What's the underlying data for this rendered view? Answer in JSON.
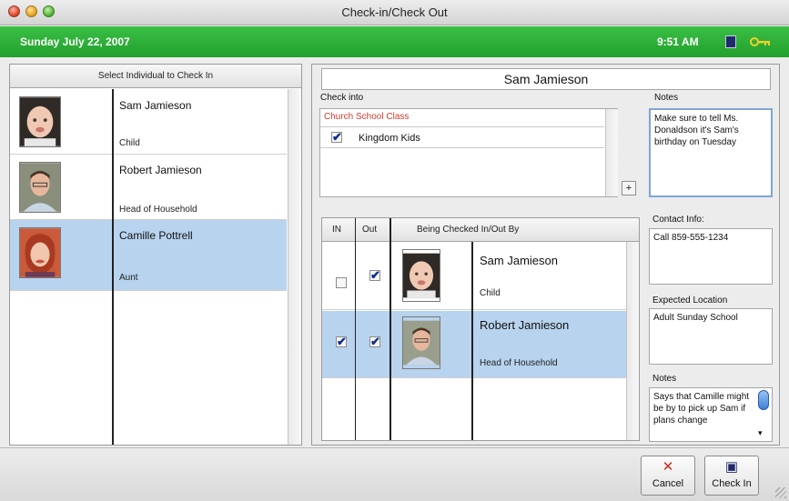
{
  "window": {
    "title": "Check-in/Check Out"
  },
  "header": {
    "date": "Sunday July 22, 2007",
    "time": "9:51 AM"
  },
  "left_panel": {
    "title": "Select Individual to Check In",
    "people": [
      {
        "name": "Sam Jamieson",
        "role": "Child"
      },
      {
        "name": "Robert Jamieson",
        "role": "Head of Household"
      },
      {
        "name": "Camille Pottrell",
        "role": "Aunt"
      }
    ]
  },
  "right_panel": {
    "selected_name": "Sam Jamieson",
    "check_into_label": "Check into",
    "class_header": "Church School Class",
    "class_item": "Kingdom Kids",
    "plus_label": "+",
    "notes_label": "Notes",
    "notes_text": "Make sure to tell Ms. Donaldson it's Sam's birthday on Tuesday",
    "grid": {
      "col_in": "IN",
      "col_out": "Out",
      "col_by": "Being Checked In/Out By",
      "rows": [
        {
          "name": "Sam Jamieson",
          "role": "Child",
          "in": false,
          "out": true
        },
        {
          "name": "Robert Jamieson",
          "role": "Head of Household",
          "in": true,
          "out": true
        }
      ]
    },
    "contact_label": "Contact Info:",
    "contact_text": "Call 859-555-1234",
    "location_label": "Expected Location",
    "location_text": "Adult Sunday School",
    "notes2_label": "Notes",
    "notes2_text": "Says that Camille might be by to pick up Sam if plans change"
  },
  "buttons": {
    "cancel_label": "Cancel",
    "checkin_label": "Check In"
  },
  "colors": {
    "header_green": "#22a02d",
    "selection_blue": "#b8d3ee",
    "class_red": "#d33a2c"
  }
}
